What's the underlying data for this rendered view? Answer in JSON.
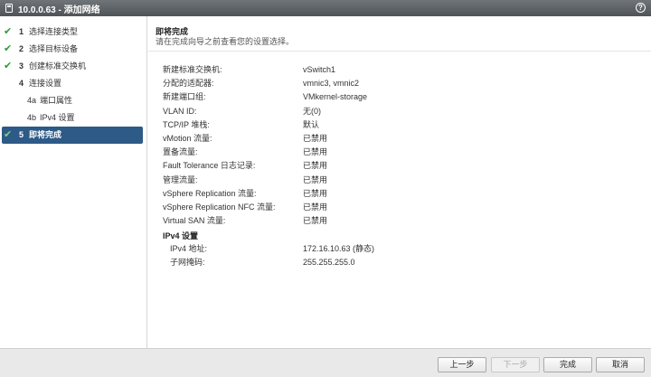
{
  "window": {
    "title": "10.0.0.63 - 添加网络",
    "help_label": "?"
  },
  "steps": [
    {
      "num": "1",
      "label": "选择连接类型",
      "done": true
    },
    {
      "num": "2",
      "label": "选择目标设备",
      "done": true
    },
    {
      "num": "3",
      "label": "创建标准交换机",
      "done": true
    },
    {
      "num": "4",
      "label": "连接设置",
      "done": false
    },
    {
      "num": "4a",
      "label": "端口属性",
      "done": false
    },
    {
      "num": "4b",
      "label": "IPv4 设置",
      "done": false
    },
    {
      "num": "5",
      "label": "即将完成",
      "done": true
    }
  ],
  "main": {
    "title": "即将完成",
    "subtitle": "请在完成向导之前查看您的设置选择。",
    "rows": [
      {
        "k": "新建标准交换机:",
        "v": "vSwitch1"
      },
      {
        "k": "分配的适配器:",
        "v": "vmnic3, vmnic2"
      },
      {
        "k": "新建端口组:",
        "v": "VMkernel-storage"
      },
      {
        "k": "VLAN ID:",
        "v": "无(0)"
      },
      {
        "k": "TCP/IP 堆栈:",
        "v": "默认"
      },
      {
        "k": "vMotion 流量:",
        "v": "已禁用"
      },
      {
        "k": "置备流量:",
        "v": "已禁用"
      },
      {
        "k": "Fault Tolerance 日志记录:",
        "v": "已禁用"
      },
      {
        "k": "管理流量:",
        "v": "已禁用"
      },
      {
        "k": "vSphere Replication 流量:",
        "v": "已禁用"
      },
      {
        "k": "vSphere Replication NFC 流量:",
        "v": "已禁用"
      },
      {
        "k": "Virtual SAN 流量:",
        "v": "已禁用"
      }
    ],
    "ipv4_title": "IPv4 设置",
    "ipv4_rows": [
      {
        "k": "IPv4 地址:",
        "v": "172.16.10.63 (静态)"
      },
      {
        "k": "子网掩码:",
        "v": "255.255.255.0"
      }
    ]
  },
  "footer": {
    "back_label": "上一步",
    "next_label": "下一步",
    "finish_label": "完成",
    "cancel_label": "取消"
  }
}
